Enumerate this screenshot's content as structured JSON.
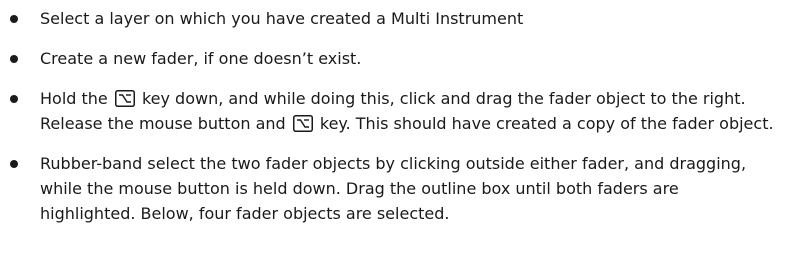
{
  "steps": [
    {
      "text": "Select a layer on which you have created a Multi Instrument"
    },
    {
      "text": "Create a new fader, if one doesn’t exist."
    },
    {
      "before_key_1": "Hold the",
      "between_keys": "key down, and while doing this, click and drag the fader object to the right. Release the mouse button and",
      "after_key_2": "key. This should have created a copy of the fader object.",
      "key_icon": "option-key-icon"
    },
    {
      "text": "Rubber-band select the two fader objects by clicking outside either fader, and dragging, while the mouse button is held down. Drag the outline box until both faders are highlighted. Below, four fader objects are selected."
    }
  ]
}
